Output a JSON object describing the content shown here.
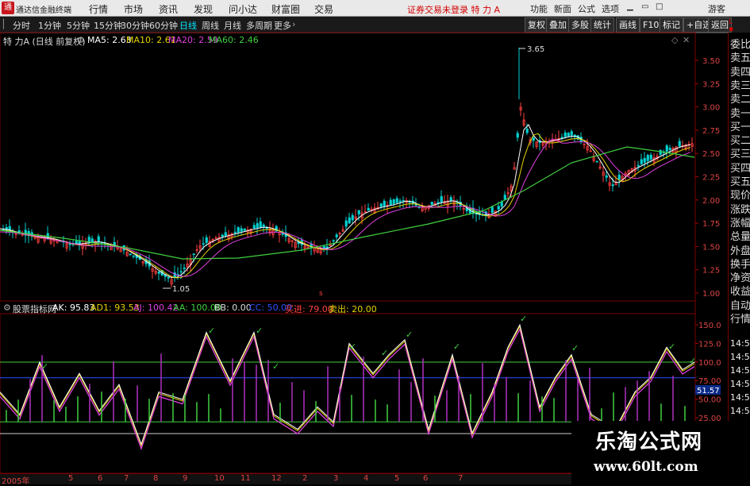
{
  "topbar": {
    "app_name": "通达信金融终端",
    "menu": [
      "行情",
      "市场",
      "资讯",
      "发现",
      "问小达",
      "财富圈",
      "交易"
    ],
    "notice": "证券交易未登录  特 力 A",
    "right_buttons": [
      "功能",
      "新面",
      "公式",
      "选项"
    ],
    "guest": "游客"
  },
  "toolbar": {
    "periods": [
      "分时",
      "1分钟",
      "5分钟",
      "15分钟",
      "30分钟",
      "60分钟",
      "日线",
      "周线",
      "月线",
      "多周期",
      "更多"
    ],
    "active_period": "日线",
    "right_buttons": [
      "复权",
      "叠加",
      "多股",
      "统计",
      "画线",
      "F10",
      "标记",
      "+自选",
      "返回"
    ]
  },
  "main_chart": {
    "stock_label": "特 力A (日线 前复权)",
    "ma": [
      {
        "label": "MA5: 2.63",
        "color": "#ffffff"
      },
      {
        "label": "MA10: 2.61",
        "color": "#e6d200"
      },
      {
        "label": "MA20: 2.59",
        "color": "#e040e0"
      },
      {
        "label": "MA60: 2.46",
        "color": "#40d040"
      }
    ],
    "high_label": "3.65",
    "low_label": "1.05",
    "price_ticks": [
      "3.50",
      "3.25",
      "3.00",
      "2.75",
      "2.50",
      "2.25",
      "2.00",
      "1.75",
      "1.50",
      "1.25",
      "1.00"
    ]
  },
  "indicator": {
    "name": "股票指标网",
    "values": [
      {
        "label": "AK: 95.83",
        "color": "#ffffff"
      },
      {
        "label": "AD1: 93.53",
        "color": "#e6d200"
      },
      {
        "label": "AJ: 100.42",
        "color": "#e040e0"
      },
      {
        "label": "AA: 100.00",
        "color": "#40d040"
      },
      {
        "label": "BB: 0.00",
        "color": "#dddddd"
      },
      {
        "label": "CC: 50.00",
        "color": "#3050ff"
      },
      {
        "label": "买进: 79.00",
        "color": "#ff4040"
      },
      {
        "label": "卖出: 20.00",
        "color": "#e6d200"
      }
    ],
    "ticks": [
      "150.0",
      "125.0",
      "100.0",
      "75.00",
      "50.00",
      "25.00"
    ],
    "current_value": "51.57"
  },
  "side_panel": {
    "items": [
      "委比",
      "卖五",
      "卖四",
      "卖三",
      "卖二",
      "卖一",
      "买一",
      "买二",
      "买三",
      "买四",
      "买五",
      "现价",
      "涨跌",
      "涨幅",
      "总量",
      "外盘",
      "换手",
      "净资",
      "收益",
      "自动",
      "行情"
    ],
    "times": [
      "14:5",
      "14:5",
      "14:5",
      "14:5",
      "14:5",
      "14:5",
      "14:5"
    ]
  },
  "bottom_axis": {
    "labels": [
      "2005年",
      "5",
      "6",
      "7",
      "8",
      "9",
      "10",
      "11",
      "12",
      "2",
      "3",
      "4",
      "5",
      "6",
      "7"
    ]
  },
  "watermark": {
    "title": "乐淘公式网",
    "url": "www.60lt.com"
  }
}
